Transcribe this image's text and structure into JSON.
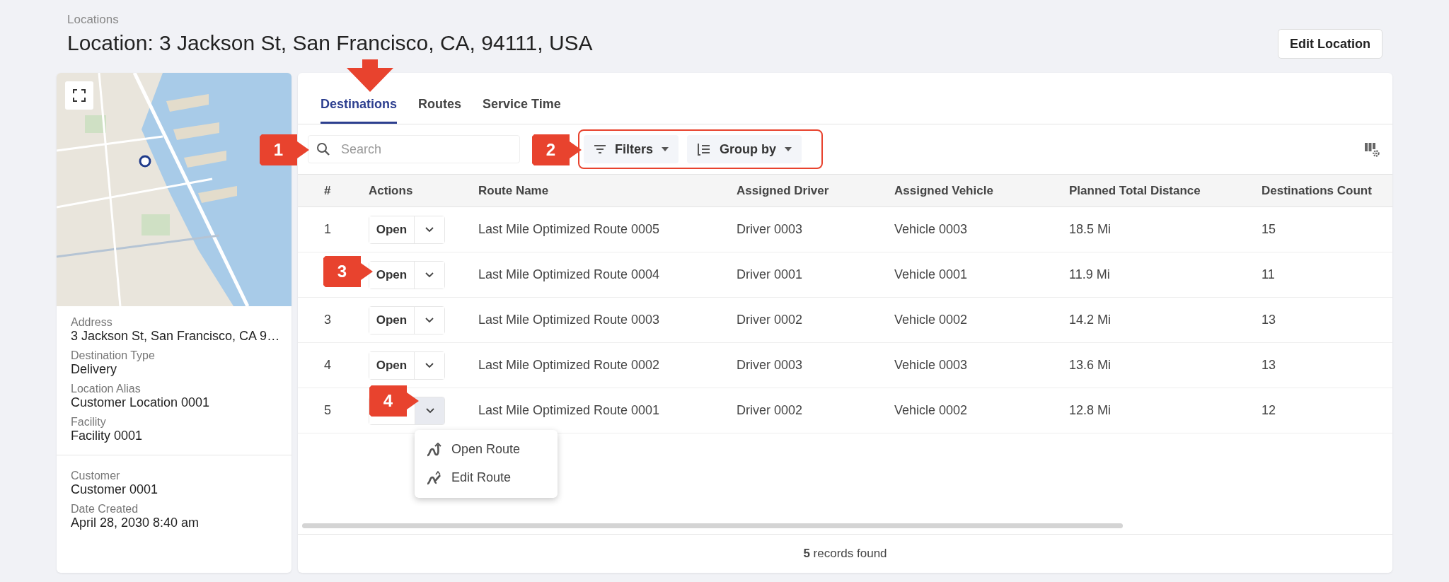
{
  "breadcrumb": "Locations",
  "title": "Location: 3 Jackson St, San Francisco, CA, 94111, USA",
  "edit_button": "Edit Location",
  "location_card": {
    "map": {
      "kind": "picture"
    },
    "groups": [
      [
        {
          "label": "Address",
          "value": "3 Jackson St, San Francisco, CA 9…"
        },
        {
          "label": "Destination Type",
          "value": "Delivery"
        },
        {
          "label": "Location Alias",
          "value": "Customer Location 0001"
        },
        {
          "label": "Facility",
          "value": "Facility 0001"
        }
      ],
      [
        {
          "label": "Customer",
          "value": "Customer 0001"
        },
        {
          "label": "Date Created",
          "value": "April 28, 2030 8:40 am"
        }
      ]
    ]
  },
  "tabs": [
    {
      "label": "Destinations",
      "selected": true
    },
    {
      "label": "Routes",
      "selected": false
    },
    {
      "label": "Service Time",
      "selected": false
    }
  ],
  "search": {
    "placeholder": "Search"
  },
  "toolbar_buttons": [
    {
      "kind": "filter",
      "label": "Filters"
    },
    {
      "kind": "group",
      "label": "Group by"
    }
  ],
  "table": {
    "columns": [
      "#",
      "Actions",
      "Route Name",
      "Assigned Driver",
      "Assigned Vehicle",
      "Planned Total Distance",
      "Destinations Count"
    ],
    "rows": [
      {
        "open_label": "Open",
        "expanded": false,
        "cells": [
          "1",
          "",
          "Last Mile Optimized Route 0005",
          "Driver 0003",
          "Vehicle 0003",
          "18.5 Mi",
          "15"
        ]
      },
      {
        "open_label": "Open",
        "expanded": false,
        "cells": [
          "",
          "",
          "Last Mile Optimized Route 0004",
          "Driver 0001",
          "Vehicle 0001",
          "11.9 Mi",
          "11"
        ]
      },
      {
        "open_label": "Open",
        "expanded": false,
        "cells": [
          "3",
          "",
          "Last Mile Optimized Route 0003",
          "Driver 0002",
          "Vehicle 0002",
          "14.2 Mi",
          "13"
        ]
      },
      {
        "open_label": "Open",
        "expanded": false,
        "cells": [
          "4",
          "",
          "Last Mile Optimized Route 0002",
          "Driver 0003",
          "Vehicle 0003",
          "13.6 Mi",
          "13"
        ]
      },
      {
        "expanded": true,
        "cells": [
          "5",
          "",
          "Last Mile Optimized Route 0001",
          "Driver 0002",
          "Vehicle 0002",
          "12.8 Mi",
          "12"
        ]
      }
    ]
  },
  "action_menu": [
    {
      "kind": "open",
      "label": "Open Route"
    },
    {
      "kind": "edit",
      "label": "Edit Route"
    }
  ],
  "footer": "**5** records found",
  "callouts": [
    "1",
    "2",
    "3",
    "4"
  ]
}
